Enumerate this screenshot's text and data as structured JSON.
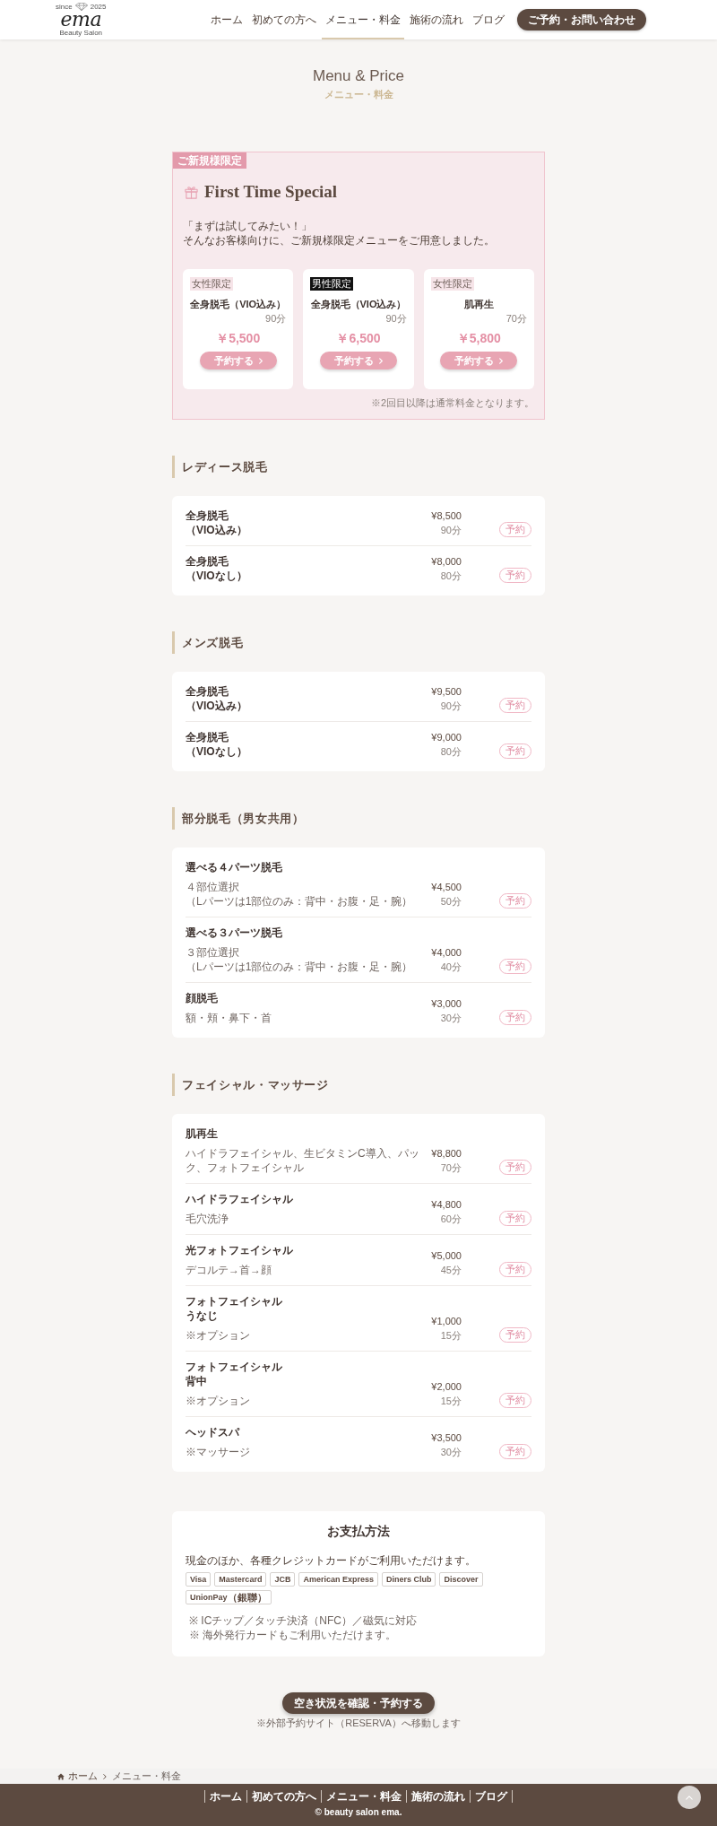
{
  "header": {
    "logo": {
      "since": "since",
      "year": "2025",
      "name": "ema",
      "tagline": "Beauty Salon"
    },
    "nav": [
      {
        "label": "ホーム",
        "selected": false
      },
      {
        "label": "初めての方へ",
        "selected": false
      },
      {
        "label": "メニュー・料金",
        "selected": true
      },
      {
        "label": "施術の流れ",
        "selected": false
      },
      {
        "label": "ブログ",
        "selected": false
      }
    ],
    "cta": "ご予約・お問い合わせ"
  },
  "page_title": {
    "title": "Menu & Price",
    "subtitle": "メニュー・料金"
  },
  "special": {
    "badge": "ご新規様限定",
    "title": "First Time Special",
    "intro": [
      "「まずは試してみたい！」",
      "そんなお客様向けに、ご新規様限定メニューをご用意しました。"
    ],
    "offers": [
      {
        "tag": {
          "text": "女性限定",
          "kind": "female"
        },
        "name": "全身脱毛（VIO込み）",
        "duration": "90分",
        "price": "￥5,500",
        "button": "予約する"
      },
      {
        "tag": {
          "text": "男性限定",
          "kind": "male"
        },
        "name": "全身脱毛（VIO込み）",
        "duration": "90分",
        "price": "￥6,500",
        "button": "予約する"
      },
      {
        "tag": {
          "text": "女性限定",
          "kind": "female"
        },
        "name": "肌再生",
        "duration": "70分",
        "price": "￥5,800",
        "button": "予約する"
      }
    ],
    "note": "※2回目以降は通常料金となります。"
  },
  "sections": [
    {
      "title": "レディース脱毛",
      "items": [
        {
          "name": [
            "全身脱毛",
            "（VIO込み）"
          ],
          "price": "¥8,500",
          "duration": "90分",
          "button": "予約"
        },
        {
          "name": [
            "全身脱毛",
            "（VIOなし）"
          ],
          "price": "¥8,000",
          "duration": "80分",
          "button": "予約"
        }
      ]
    },
    {
      "title": "メンズ脱毛",
      "items": [
        {
          "name": [
            "全身脱毛",
            "（VIO込み）"
          ],
          "price": "¥9,500",
          "duration": "90分",
          "button": "予約"
        },
        {
          "name": [
            "全身脱毛",
            "（VIOなし）"
          ],
          "price": "¥9,000",
          "duration": "80分",
          "button": "予約"
        }
      ]
    },
    {
      "title": "部分脱毛（男女共用）",
      "items": [
        {
          "name": [
            "選べる４パーツ脱毛"
          ],
          "details": [
            "４部位選択",
            "（Lパーツは1部位のみ：背中・お腹・足・腕）"
          ],
          "price": "¥4,500",
          "duration": "50分",
          "button": "予約"
        },
        {
          "name": [
            "選べる３パーツ脱毛"
          ],
          "details": [
            "３部位選択",
            "（Lパーツは1部位のみ：背中・お腹・足・腕）"
          ],
          "price": "¥4,000",
          "duration": "40分",
          "button": "予約"
        },
        {
          "name": [
            "顔脱毛"
          ],
          "details": [
            "額・頬・鼻下・首"
          ],
          "price": "¥3,000",
          "duration": "30分",
          "button": "予約"
        }
      ]
    },
    {
      "title": "フェイシャル・マッサージ",
      "items": [
        {
          "name": [
            "肌再生"
          ],
          "details": [
            "ハイドラフェイシャル、生ビタミンC導入、パック、フォトフェイシャル"
          ],
          "price": "¥8,800",
          "duration": "70分",
          "button": "予約"
        },
        {
          "name": [
            "ハイドラフェイシャル"
          ],
          "details": [
            "毛穴洗浄"
          ],
          "price": "¥4,800",
          "duration": "60分",
          "button": "予約"
        },
        {
          "name": [
            "光フォトフェイシャル"
          ],
          "details": [
            "デコルテ→首→顔"
          ],
          "price": "¥5,000",
          "duration": "45分",
          "button": "予約"
        },
        {
          "name": [
            "フォトフェイシャル",
            "うなじ"
          ],
          "details": [
            "※オプション"
          ],
          "price": "¥1,000",
          "duration": "15分",
          "button": "予約"
        },
        {
          "name": [
            "フォトフェイシャル",
            "背中"
          ],
          "details": [
            "※オプション"
          ],
          "price": "¥2,000",
          "duration": "15分",
          "button": "予約"
        },
        {
          "name": [
            "ヘッドスパ"
          ],
          "details": [
            "※マッサージ"
          ],
          "price": "¥3,500",
          "duration": "30分",
          "button": "予約"
        }
      ]
    }
  ],
  "payment": {
    "title": "お支払方法",
    "text": "現金のほか、各種クレジットカードがご利用いただけます。",
    "cards": [
      "Visa",
      "Mastercard",
      "JCB",
      "American Express",
      "Diners Club",
      "Discover",
      "UnionPay（銀聯）"
    ],
    "notes": [
      "※ ICチップ／タッチ決済（NFC）／磁気に対応",
      "※ 海外発行カードもご利用いただけます。"
    ]
  },
  "reserve": {
    "button": "空き状況を確認・予約する",
    "note": "※外部予約サイト（RESERVA）へ移動します"
  },
  "breadcrumb": {
    "home": "ホーム",
    "current": "メニュー・料金"
  },
  "footer": {
    "links": [
      "ホーム",
      "初めての方へ",
      "メニュー・料金",
      "施術の流れ",
      "ブログ"
    ],
    "copyright": "© beauty salon ema."
  }
}
